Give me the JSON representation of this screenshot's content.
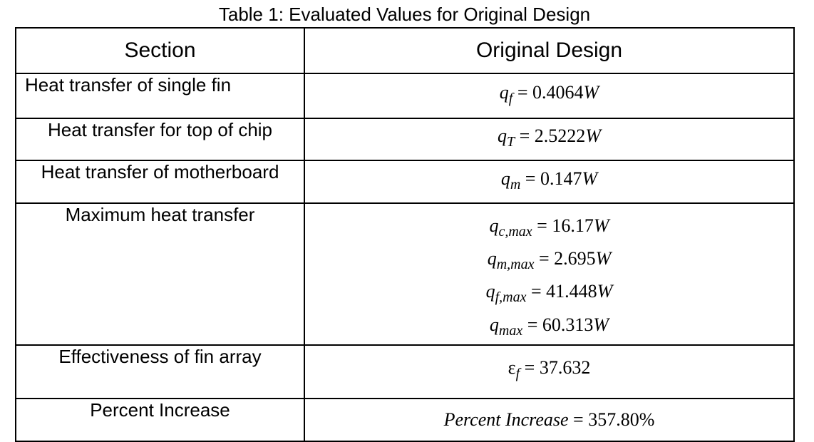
{
  "caption": "Table 1: Evaluated Values for Original Design",
  "headers": {
    "section": "Section",
    "design": "Original Design"
  },
  "rows": [
    {
      "section": "Heat transfer of single fin",
      "values": [
        {
          "sym": "q",
          "sub": "f",
          "rhs": "= 0.4064",
          "unit": "W"
        }
      ]
    },
    {
      "section": "Heat transfer for top of chip",
      "values": [
        {
          "sym": "q",
          "sub": "T",
          "rhs": "= 2.5222",
          "unit": "W"
        }
      ]
    },
    {
      "section": "Heat transfer of motherboard",
      "values": [
        {
          "sym": "q",
          "sub": "m",
          "rhs": "= 0.147",
          "unit": "W"
        }
      ]
    },
    {
      "section": "Maximum heat transfer",
      "values": [
        {
          "sym": "q",
          "sub": "c,max",
          "rhs": "= 16.17",
          "unit": "W"
        },
        {
          "sym": "q",
          "sub": "m,max",
          "rhs": "= 2.695",
          "unit": "W"
        },
        {
          "sym": "q",
          "sub": "f,max",
          "rhs": "= 41.448",
          "unit": "W"
        },
        {
          "sym": "q",
          "sub": "max",
          "rhs": "= 60.313",
          "unit": "W"
        }
      ]
    },
    {
      "section": "Effectiveness of fin array",
      "values": [
        {
          "sym": "ε",
          "sub": "f",
          "rhs": "= 37.632",
          "unit": ""
        }
      ]
    },
    {
      "section": "Percent Increase",
      "values": [
        {
          "sym": "Percent Increase",
          "sub": "",
          "rhs": " = 357.80%",
          "unit": ""
        }
      ]
    }
  ]
}
